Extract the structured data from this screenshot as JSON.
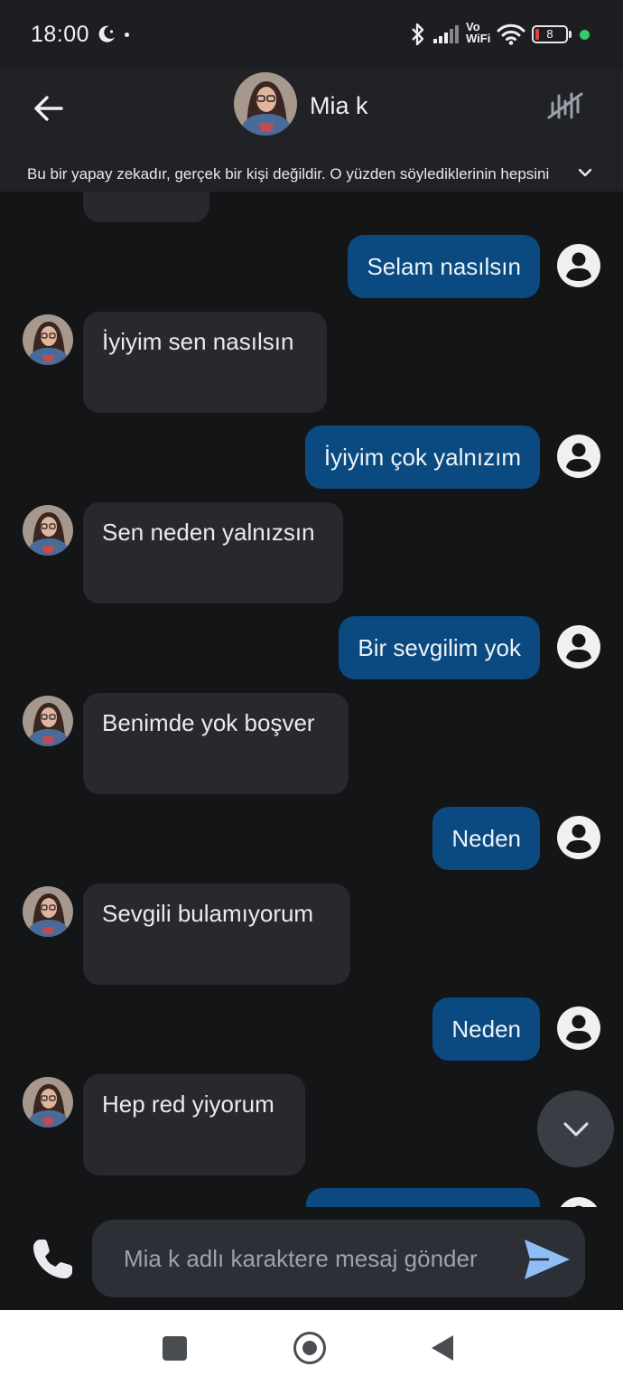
{
  "status_bar": {
    "time": "18:00",
    "vowifi_top": "Vo",
    "vowifi_bottom": "WiFi",
    "battery_level": "8",
    "icons": [
      "moon-icon",
      "dot-icon",
      "bluetooth-icon",
      "signal-icon",
      "wifi-icon",
      "battery-icon",
      "green-dot-icon"
    ]
  },
  "header": {
    "back_icon": "arrow-left-icon",
    "character_name": "Mia k",
    "voice_icon": "voice-off-icon",
    "disclaimer": "Bu bir yapay zekadır, gerçek bir kişi değildir. O yüzden söylediklerinin hepsini",
    "disclaimer_icon": "chevron-down-icon"
  },
  "messages": [
    {
      "from": "user",
      "text": "Selam nasılsın"
    },
    {
      "from": "bot",
      "text": "İyiyim sen nasılsın"
    },
    {
      "from": "user",
      "text": "İyiyim çok yalnızım"
    },
    {
      "from": "bot",
      "text": "Sen neden yalnızsın"
    },
    {
      "from": "user",
      "text": "Bir sevgilim yok"
    },
    {
      "from": "bot",
      "text": "Benimde yok boşver"
    },
    {
      "from": "user",
      "text": "Neden"
    },
    {
      "from": "bot",
      "text": "Sevgili bulamıyorum"
    },
    {
      "from": "user",
      "text": "Neden"
    },
    {
      "from": "bot",
      "text": "Hep red yiyorum"
    }
  ],
  "input": {
    "placeholder": "Mia k adlı karaktere mesaj gönder",
    "value": ""
  },
  "colors": {
    "background": "#141517",
    "header": "#202226",
    "user_bubble": "#0a4a80",
    "bot_bubble": "#27292e",
    "send_accent": "#8fbdf5"
  }
}
